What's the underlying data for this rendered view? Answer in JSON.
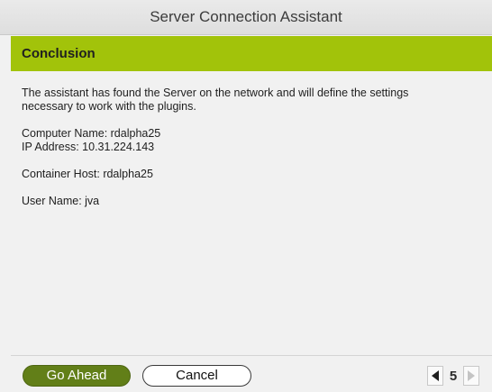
{
  "window": {
    "title": "Server Connection Assistant"
  },
  "banner": {
    "heading": "Conclusion",
    "color": "#a2c30a"
  },
  "content": {
    "intro_line1": "The assistant has found the Server on the network and will define the settings",
    "intro_line2": "necessary to work with the plugins.",
    "computer_name": "Computer Name:  rdalpha25",
    "ip_address": "IP Address:  10.31.224.143",
    "container_host": "Container Host: rdalpha25",
    "user_name": "User Name: jva"
  },
  "footer": {
    "go_ahead_label": "Go Ahead",
    "cancel_label": "Cancel",
    "page_number": "5",
    "primary_color": "#627f18"
  }
}
